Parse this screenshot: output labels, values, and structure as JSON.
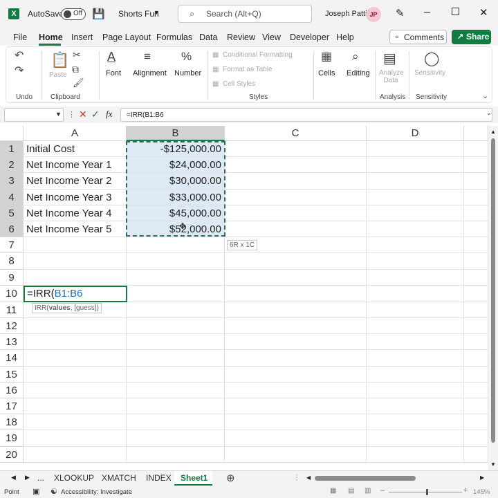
{
  "app": {
    "autosave_label": "AutoSave",
    "autosave_state": "Off",
    "file_name": "Shorts Fun",
    "search_placeholder": "Search (Alt+Q)",
    "user_name": "Joseph Patti",
    "user_initials": "JP"
  },
  "menu": {
    "tabs": [
      "File",
      "Home",
      "Insert",
      "Page Layout",
      "Formulas",
      "Data",
      "Review",
      "View",
      "Developer",
      "Help"
    ],
    "active_tab": "Home",
    "comments_label": "Comments",
    "share_label": "Share"
  },
  "ribbon": {
    "undo_group": "Undo",
    "paste": "Paste",
    "clipboard_group": "Clipboard",
    "font": "Font",
    "alignment": "Alignment",
    "number": "Number",
    "conditional_formatting": "Conditional Formatting",
    "format_as_table": "Format as Table",
    "cell_styles": "Cell Styles",
    "styles_group": "Styles",
    "cells": "Cells",
    "editing": "Editing",
    "analyze_data": "Analyze Data",
    "analysis_group": "Analysis",
    "sensitivity": "Sensitivity",
    "sensitivity_group": "Sensitivity"
  },
  "formula_bar": {
    "name_box": "",
    "fx": "fx",
    "formula": "=IRR(B1:B6"
  },
  "sheet": {
    "columns": [
      "A",
      "B",
      "C",
      "D"
    ],
    "rows": [
      {
        "num": "1",
        "a": "Initial Cost",
        "b": "-$125,000.00"
      },
      {
        "num": "2",
        "a": "Net Income Year 1",
        "b": "$24,000.00"
      },
      {
        "num": "3",
        "a": "Net Income Year 2",
        "b": "$30,000.00"
      },
      {
        "num": "4",
        "a": "Net Income Year 3",
        "b": "$33,000.00"
      },
      {
        "num": "5",
        "a": "Net Income Year 4",
        "b": "$45,000.00"
      },
      {
        "num": "6",
        "a": "Net Income Year 5",
        "b": "$52,000.00"
      },
      {
        "num": "7",
        "a": "",
        "b": ""
      },
      {
        "num": "8",
        "a": "",
        "b": ""
      },
      {
        "num": "9",
        "a": "",
        "b": ""
      },
      {
        "num": "10",
        "a": "",
        "b": ""
      },
      {
        "num": "11",
        "a": "",
        "b": ""
      },
      {
        "num": "12",
        "a": "",
        "b": ""
      },
      {
        "num": "13",
        "a": "",
        "b": ""
      },
      {
        "num": "14",
        "a": "",
        "b": ""
      },
      {
        "num": "15",
        "a": "",
        "b": ""
      },
      {
        "num": "16",
        "a": "",
        "b": ""
      },
      {
        "num": "17",
        "a": "",
        "b": ""
      },
      {
        "num": "18",
        "a": "",
        "b": ""
      },
      {
        "num": "19",
        "a": "",
        "b": ""
      },
      {
        "num": "20",
        "a": "",
        "b": ""
      }
    ],
    "selection_size_tip": "6R x 1C",
    "edit_cell_prefix": "=IRR(",
    "edit_cell_ref": "B1:B6",
    "fn_tip_name": "IRR(",
    "fn_tip_arg": "values",
    "fn_tip_rest": ", [guess])"
  },
  "sheet_tabs": {
    "ellipsis": "...",
    "tabs": [
      "XLOOKUP",
      "XMATCH",
      "INDEX",
      "Sheet1"
    ],
    "active": "Sheet1"
  },
  "status_bar": {
    "mode": "Point",
    "accessibility": "Accessibility: Investigate",
    "zoom": "145%"
  },
  "colors": {
    "accent": "#107c41",
    "selection_fill": "#dde9f5",
    "reference_blue": "#1e6fb5"
  }
}
